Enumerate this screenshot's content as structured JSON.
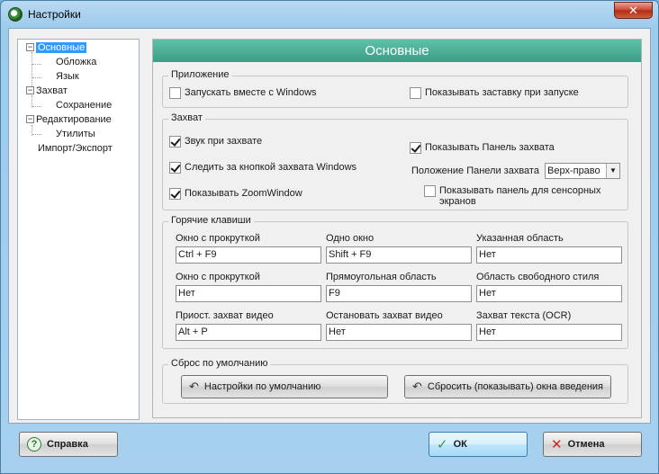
{
  "window": {
    "title": "Настройки",
    "close_symbol": "✕"
  },
  "tree": {
    "items": [
      {
        "label": "Основные",
        "toggle": "−"
      },
      {
        "label": "Обложка"
      },
      {
        "label": "Язык"
      },
      {
        "label": "Захват",
        "toggle": "−"
      },
      {
        "label": "Сохранение"
      },
      {
        "label": "Редактирование",
        "toggle": "−"
      },
      {
        "label": "Утилиты"
      },
      {
        "label": "Импорт/Экспорт"
      }
    ]
  },
  "panel": {
    "title": "Основные"
  },
  "app_group": {
    "label": "Приложение",
    "start_with_windows": {
      "label": "Запускать вместе с Windows",
      "checked": false
    },
    "show_splash": {
      "label": "Показывать заставку при запуске",
      "checked": false
    }
  },
  "capture_group": {
    "label": "Захват",
    "sound": {
      "label": "Звук при захвате",
      "checked": true
    },
    "follow_key": {
      "label": "Следить за кнопкой захвата Windows",
      "checked": true
    },
    "zoom_window": {
      "label": "Показывать ZoomWindow",
      "checked": true
    },
    "show_panel": {
      "label": "Показывать Панель захвата",
      "checked": true
    },
    "panel_position_label": "Положение Панели захвата",
    "panel_position_value": "Верх-право",
    "touch_panel": {
      "label": "Показывать панель для сенсорных экранов",
      "checked": false
    }
  },
  "hotkeys_group": {
    "label": "Горячие клавиши",
    "cells": [
      {
        "label": "Окно с прокруткой",
        "value": "Ctrl + F9"
      },
      {
        "label": "Одно окно",
        "value": "Shift + F9"
      },
      {
        "label": "Указанная область",
        "value": "Нет"
      },
      {
        "label": "Окно с прокруткой",
        "value": "Нет"
      },
      {
        "label": "Прямоугольная область",
        "value": "F9"
      },
      {
        "label": "Область свободного стиля",
        "value": "Нет"
      },
      {
        "label": "Приост. захват видео",
        "value": "Alt + P"
      },
      {
        "label": "Остановать захват видео",
        "value": "Нет"
      },
      {
        "label": "Захват текста (OCR)",
        "value": "Нет"
      }
    ]
  },
  "reset_group": {
    "label": "Сброс по умолчанию",
    "defaults_button": "Настройки по умолчанию",
    "reset_tips_button": "Сбросить (показывать) окна введения"
  },
  "footer": {
    "help_button": "Справка",
    "ok_button": "ОК",
    "cancel_button": "Отмена"
  }
}
